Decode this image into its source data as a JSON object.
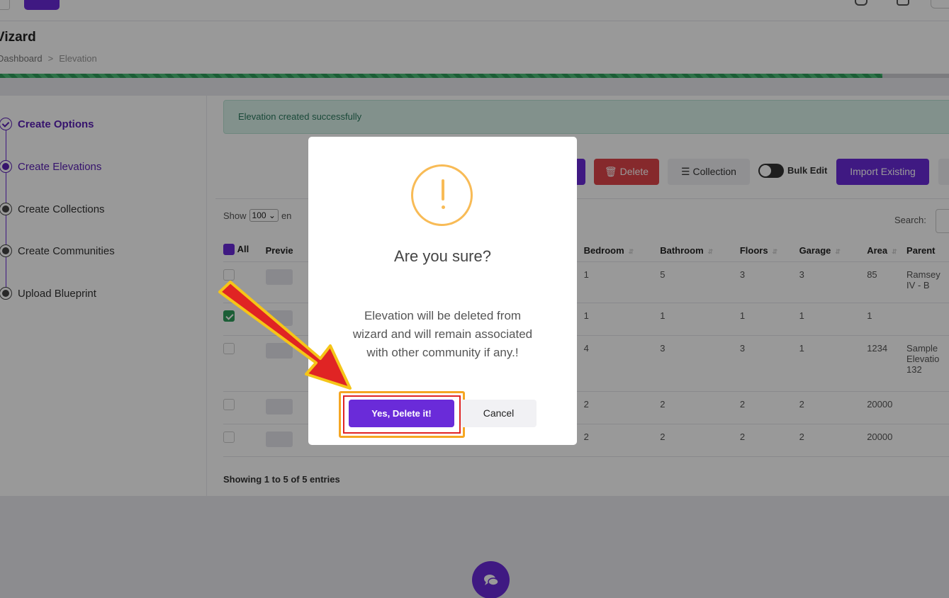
{
  "header": {
    "title": "Vizard",
    "breadcrumb": {
      "home": "Dashboard",
      "separator": ">",
      "current": "Elevation"
    }
  },
  "progress": {
    "percent": 93
  },
  "steps": [
    {
      "label": "Create Options",
      "state": "done"
    },
    {
      "label": "Create Elevations",
      "state": "active"
    },
    {
      "label": "Create Collections",
      "state": "pending"
    },
    {
      "label": "Create Communities",
      "state": "pending"
    },
    {
      "label": "Upload Blueprint",
      "state": "pending"
    }
  ],
  "alert": {
    "text": "Elevation created successfully"
  },
  "toolbar": {
    "delete_label": "Delete",
    "collection_label": "Collection",
    "bulk_edit_label": "Bulk Edit",
    "import_label": "Import Existing"
  },
  "table_controls": {
    "show_label": "Show",
    "show_value": "100",
    "entries_label": "en",
    "search_label": "Search:"
  },
  "table": {
    "headers": [
      "All",
      "Previe",
      "Bedroom",
      "Bathroom",
      "Floors",
      "Garage",
      "Area",
      "Parent"
    ],
    "rows": [
      {
        "checked": false,
        "bedroom": "1",
        "bathroom": "5",
        "floors": "3",
        "garage": "3",
        "area": "85",
        "parent": "Ramsey IV - B"
      },
      {
        "checked": true,
        "bedroom": "1",
        "bathroom": "1",
        "floors": "1",
        "garage": "1",
        "area": "1",
        "parent": ""
      },
      {
        "checked": false,
        "bedroom": "4",
        "bathroom": "3",
        "floors": "3",
        "garage": "1",
        "area": "1234",
        "parent": "Sample Elevatio 132"
      },
      {
        "checked": false,
        "bedroom": "2",
        "bathroom": "2",
        "floors": "2",
        "garage": "2",
        "area": "20000",
        "parent": ""
      },
      {
        "checked": false,
        "bedroom": "2",
        "bathroom": "2",
        "floors": "2",
        "garage": "2",
        "area": "20000",
        "parent": ""
      }
    ]
  },
  "footer": {
    "info": "Showing 1 to 5 of 5 entries"
  },
  "modal": {
    "icon": "warning-icon",
    "title": "Are you sure?",
    "text": "Elevation will be deleted from wizard and will remain associated with other community if any.!",
    "confirm_label": "Yes, Delete it!",
    "cancel_label": "Cancel"
  },
  "colors": {
    "accent": "#6a2bd9",
    "danger": "#e0454a",
    "success": "#2e9d5a",
    "warning": "#f8bb56",
    "annotation": "#e02424"
  }
}
